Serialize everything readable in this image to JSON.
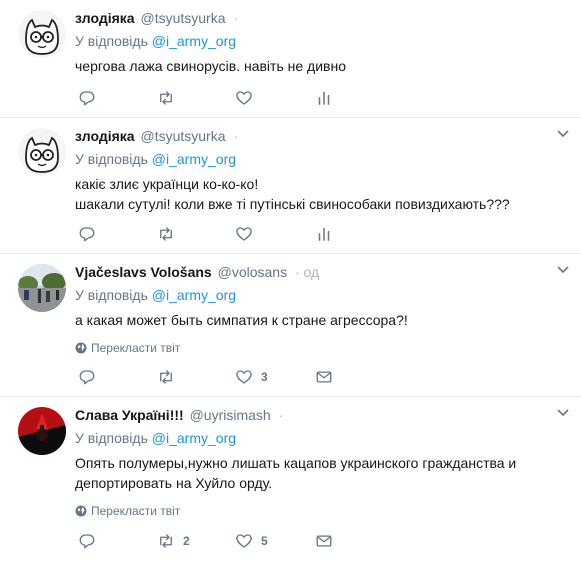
{
  "tweets": [
    {
      "author": {
        "name": "злодіяка",
        "handle": "@tsyutsyurka",
        "avatar": "cat-glasses-avatar"
      },
      "time": "·",
      "reply_prefix": "У відповідь",
      "reply_to": "@i_army_org",
      "lines": [
        "чергова лажа свинорусів. навіть не дивно"
      ],
      "translate": null,
      "counts": {
        "reply": "",
        "retweet": "",
        "like": ""
      },
      "last_action": "analytics-icon"
    },
    {
      "author": {
        "name": "злодіяка",
        "handle": "@tsyutsyurka",
        "avatar": "cat-glasses-avatar"
      },
      "time": "·",
      "reply_prefix": "У відповідь",
      "reply_to": "@i_army_org",
      "lines": [
        "какіє злиє українци ко-ко-ко!",
        "шакали сутулі! коли вже ті путінські свинособаки повиздихають???"
      ],
      "translate": null,
      "counts": {
        "reply": "",
        "retweet": "",
        "like": ""
      },
      "last_action": "analytics-icon"
    },
    {
      "author": {
        "name": "Vjačeslavs Vološans",
        "handle": "@volosans",
        "avatar": "street-photo-avatar"
      },
      "time": "· од",
      "reply_prefix": "У відповідь",
      "reply_to": "@i_army_org",
      "lines": [
        "а какая может быть симпатия к стране агрессора?!"
      ],
      "translate": "Перекласти твіт",
      "counts": {
        "reply": "",
        "retweet": "",
        "like": "3"
      },
      "last_action": "message-icon"
    },
    {
      "author": {
        "name": "Слава Україні!!!",
        "handle": "@uyrisimash",
        "avatar": "red-black-flag-avatar"
      },
      "time": "·",
      "reply_prefix": "У відповідь",
      "reply_to": "@i_army_org",
      "lines": [
        "Опять полумеры,нужно лишать кацапов украинского гражданства и",
        "депортировать на Хуйло орду."
      ],
      "translate": "Перекласти твіт",
      "counts": {
        "reply": "",
        "retweet": "2",
        "like": "5"
      },
      "last_action": "message-icon"
    }
  ],
  "colors": {
    "link": "#1b95e0",
    "muted": "#657786",
    "text": "#14171a",
    "divider": "#e6ecf0"
  }
}
